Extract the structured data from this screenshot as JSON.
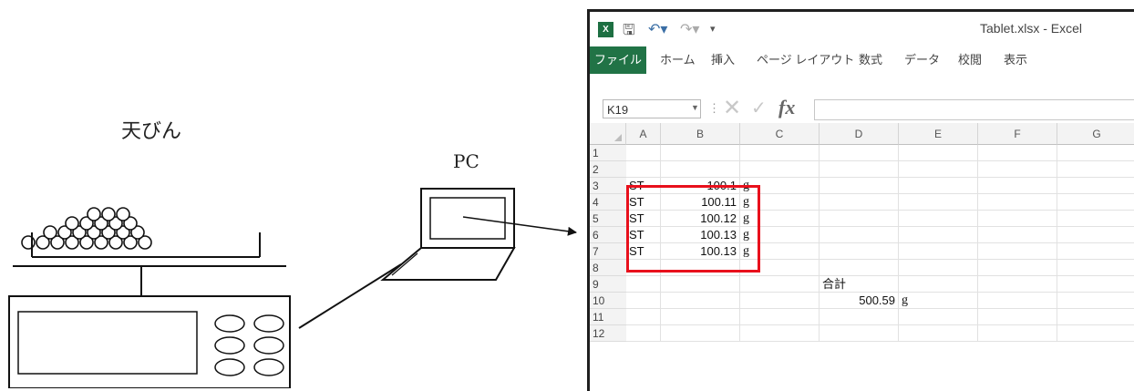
{
  "diagram": {
    "scale_label": "天びん",
    "pc_label": "PC"
  },
  "excel": {
    "window_title": "Tablet.xlsx - Excel",
    "app_icon": "X",
    "quick_access": [
      "save-icon",
      "undo-icon",
      "redo-icon",
      "customize-icon"
    ],
    "tabs": [
      "ファイル",
      "ホーム",
      "挿入",
      "ページ レイアウト",
      "数式",
      "データ",
      "校閲",
      "表示"
    ],
    "name_box": "K19",
    "formula_value": "",
    "columns": [
      "A",
      "B",
      "C",
      "D",
      "E",
      "F",
      "G"
    ],
    "rows": [
      {
        "num": "1",
        "A": "",
        "B": "",
        "C": "",
        "D": "",
        "E": ""
      },
      {
        "num": "2",
        "A": "",
        "B": "",
        "C": "",
        "D": "",
        "E": ""
      },
      {
        "num": "3",
        "A": "ST",
        "B": "100.1",
        "C": "g",
        "D": "",
        "E": ""
      },
      {
        "num": "4",
        "A": "ST",
        "B": "100.11",
        "C": "g",
        "D": "",
        "E": ""
      },
      {
        "num": "5",
        "A": "ST",
        "B": "100.12",
        "C": "g",
        "D": "",
        "E": ""
      },
      {
        "num": "6",
        "A": "ST",
        "B": "100.13",
        "C": "g",
        "D": "",
        "E": ""
      },
      {
        "num": "7",
        "A": "ST",
        "B": "100.13",
        "C": "g",
        "D": "",
        "E": ""
      },
      {
        "num": "8",
        "A": "",
        "B": "",
        "C": "",
        "D": "",
        "E": ""
      },
      {
        "num": "9",
        "A": "",
        "B": "",
        "C": "",
        "D": "合計",
        "E": ""
      },
      {
        "num": "10",
        "A": "",
        "B": "",
        "C": "",
        "D": "500.59",
        "E": "g"
      },
      {
        "num": "11",
        "A": "",
        "B": "",
        "C": "",
        "D": "",
        "E": ""
      },
      {
        "num": "12",
        "A": "",
        "B": "",
        "C": "",
        "D": "",
        "E": ""
      }
    ],
    "highlight_color": "#e8101c",
    "accent_color": "#217346"
  }
}
